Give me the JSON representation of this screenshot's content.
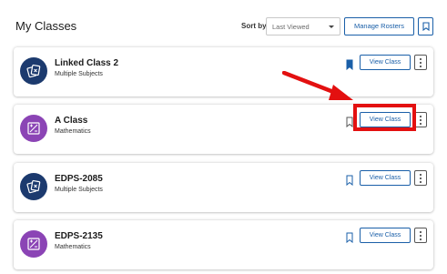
{
  "header": {
    "title": "My Classes",
    "sort_label": "Sort by",
    "sort_value": "Last Viewed",
    "manage_rosters_label": "Manage Rosters"
  },
  "colors": {
    "primary": "#1a5fa8",
    "navy_avatar": "#1c3a6e",
    "purple_avatar": "#8b44b5",
    "annotation_red": "#e31010"
  },
  "classes": [
    {
      "title": "Linked Class 2",
      "subtitle": "Multiple Subjects",
      "icon": "multiple-subjects-icon",
      "bookmarked": true,
      "view_label": "View Class"
    },
    {
      "title": "A Class",
      "subtitle": "Mathematics",
      "icon": "mathematics-icon",
      "bookmarked": false,
      "view_label": "View Class"
    },
    {
      "title": "EDPS-2085",
      "subtitle": "Multiple Subjects",
      "icon": "multiple-subjects-icon",
      "bookmarked": false,
      "view_label": "View Class"
    },
    {
      "title": "EDPS-2135",
      "subtitle": "Mathematics",
      "icon": "mathematics-icon",
      "bookmarked": false,
      "view_label": "View Class"
    }
  ]
}
